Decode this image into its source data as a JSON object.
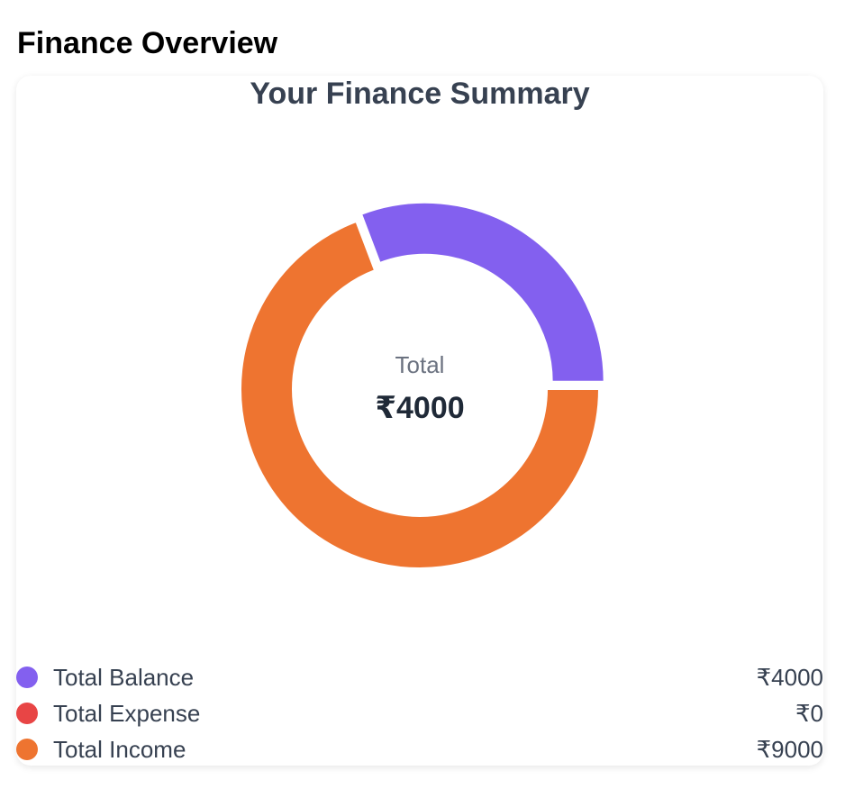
{
  "page": {
    "title": "Finance Overview"
  },
  "card": {
    "title": "Your Finance Summary"
  },
  "center": {
    "label": "Total",
    "value": "₹4000"
  },
  "chart_data": {
    "type": "pie",
    "variant": "donut",
    "categories": [
      "Total Balance",
      "Total Expense",
      "Total Income"
    ],
    "values": [
      4000,
      0,
      9000
    ],
    "display_values": [
      "₹4000",
      "₹0",
      "₹9000"
    ],
    "colors": [
      "#8360ef",
      "#e84545",
      "#ee7430"
    ],
    "legend_position": "bottom"
  }
}
